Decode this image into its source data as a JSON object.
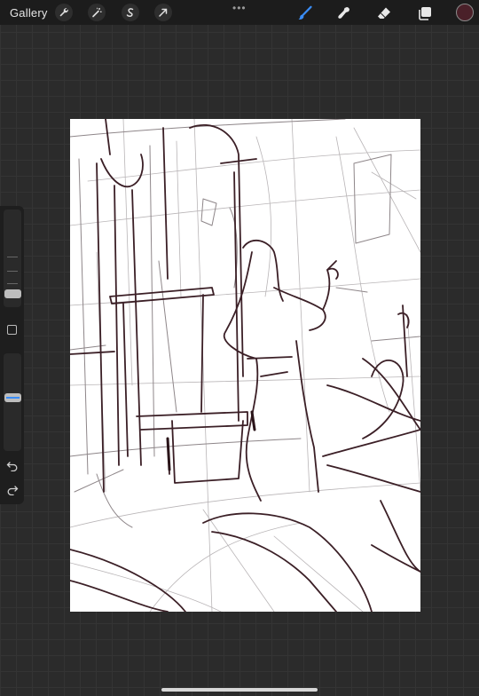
{
  "topbar": {
    "gallery_label": "Gallery",
    "left_tools": [
      "wrench-icon",
      "magic-wand-icon",
      "selection-icon",
      "transform-arrow-icon"
    ],
    "more_menu": "•••",
    "right_tools": [
      "brush-icon",
      "smudge-icon",
      "eraser-icon",
      "layers-icon"
    ],
    "active_tool": "brush",
    "accent_color": "#3a8df7",
    "current_color": "#4a2029"
  },
  "sidebar": {
    "brush_size_level": 0.1,
    "opacity_level": 0.55,
    "icons": [
      "modify-button-icon",
      "undo-icon",
      "redo-icon"
    ]
  }
}
